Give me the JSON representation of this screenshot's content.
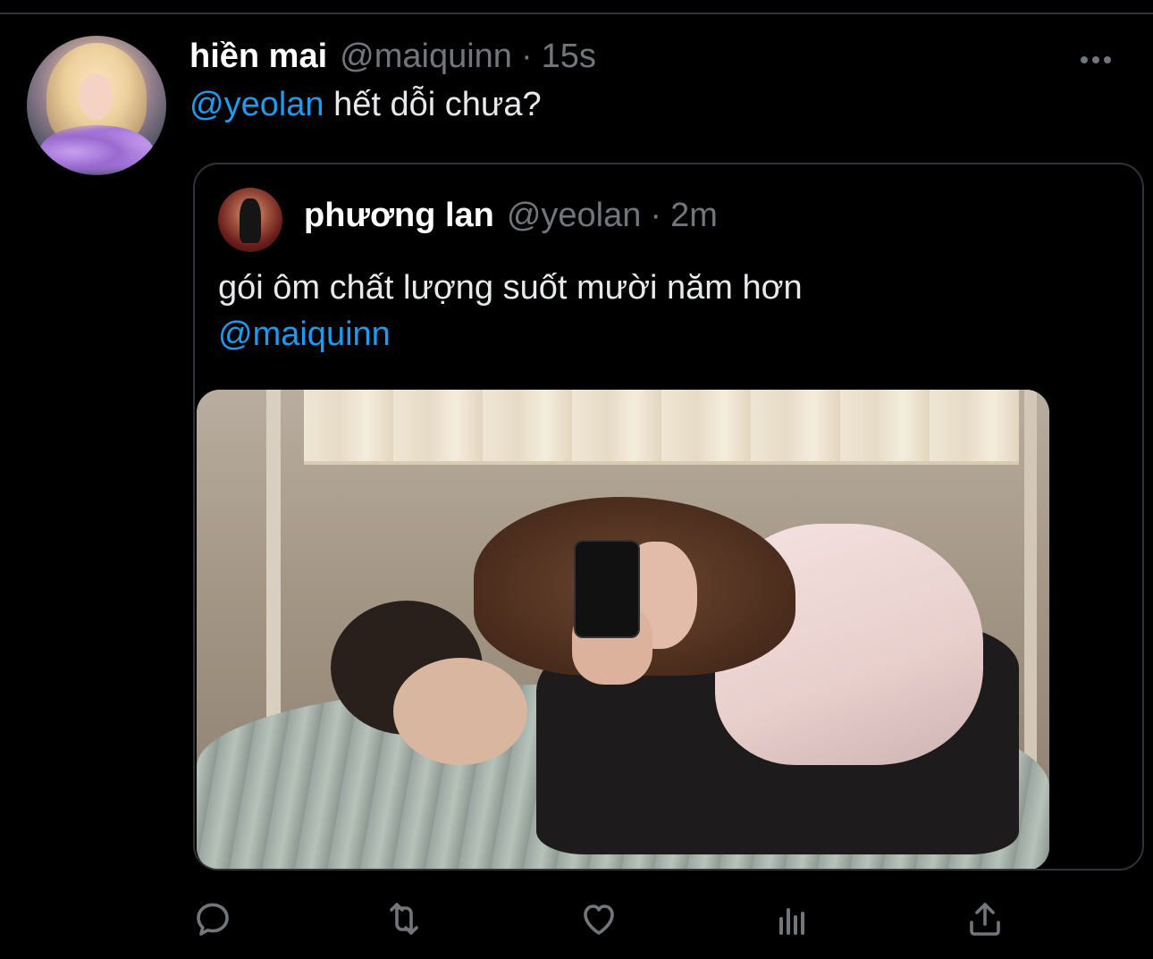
{
  "tweet": {
    "display_name": "hiền mai",
    "handle": "@maiquinn",
    "separator": "·",
    "timestamp": "15s",
    "mention": "@yeolan",
    "text": " hết dỗi chưa?"
  },
  "quoted_tweet": {
    "display_name": "phương lan",
    "handle": "@yeolan",
    "separator": "·",
    "timestamp": "2m",
    "text": "gói ôm chất lượng suốt mười năm hơn",
    "mention": "@maiquinn"
  },
  "icons": {
    "more": "more-icon",
    "reply": "reply-icon",
    "retweet": "retweet-icon",
    "like": "like-icon",
    "analytics": "analytics-icon",
    "share": "share-icon"
  },
  "colors": {
    "background": "#000000",
    "mention_blue": "#1d9bf0",
    "secondary_text": "#71767b",
    "border": "#2f3336"
  }
}
